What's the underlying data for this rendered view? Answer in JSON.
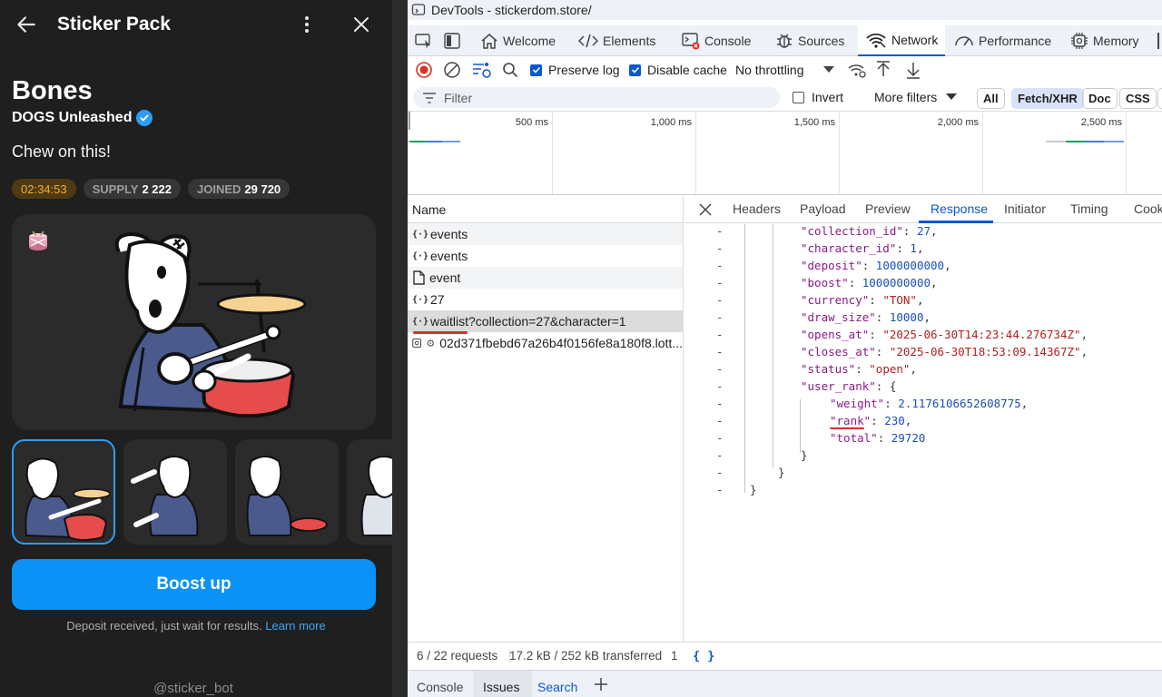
{
  "telegram": {
    "header": {
      "title": "Sticker Pack"
    },
    "pack": {
      "name": "Bones",
      "author": "DOGS Unleashed",
      "tagline": "Chew on this!",
      "timer": "02:34:53",
      "supply_label": "SUPPLY",
      "supply_value": "2 222",
      "joined_label": "JOINED",
      "joined_value": "29 720"
    },
    "boost_label": "Boost up",
    "footnote": "Deposit received, just wait for results.",
    "learn_more": "Learn more",
    "bot": "@sticker_bot"
  },
  "devtools": {
    "window_title": "DevTools - stickerdom.store/",
    "tabs": [
      {
        "label": "Welcome",
        "icon": "home-icon"
      },
      {
        "label": "Elements",
        "icon": "code-icon"
      },
      {
        "label": "Console",
        "icon": "console-icon"
      },
      {
        "label": "Sources",
        "icon": "bug-icon"
      },
      {
        "label": "Network",
        "icon": "wifi-icon",
        "active": true
      },
      {
        "label": "Performance",
        "icon": "gauge-icon"
      },
      {
        "label": "Memory",
        "icon": "chip-icon"
      }
    ],
    "toolbar": {
      "preserve_log": "Preserve log",
      "disable_cache": "Disable cache",
      "throttling": "No throttling"
    },
    "filter": {
      "placeholder": "Filter",
      "invert": "Invert",
      "more_filters": "More filters",
      "types": [
        "All",
        "Fetch/XHR",
        "Doc",
        "CSS"
      ]
    },
    "timeline_ticks": [
      "500 ms",
      "1,000 ms",
      "1,500 ms",
      "2,000 ms",
      "2,500 ms"
    ],
    "requests_header": "Name",
    "requests": [
      {
        "name": "events",
        "type": "json"
      },
      {
        "name": "events",
        "type": "json"
      },
      {
        "name": "event",
        "type": "doc"
      },
      {
        "name": "27",
        "type": "json"
      },
      {
        "name": "waitlist?collection=27&character=1",
        "type": "json",
        "selected": true
      },
      {
        "name": "02d371fbebd67a26b4f0156fe8a180f8.lott...",
        "type": "img"
      }
    ],
    "detail_tabs": [
      "Headers",
      "Payload",
      "Preview",
      "Response",
      "Initiator",
      "Timing",
      "Cooki"
    ],
    "active_detail_tab": "Response",
    "response_lines": [
      {
        "key": "collection_id",
        "value": "27",
        "vtype": "n",
        "indent": 2
      },
      {
        "key": "character_id",
        "value": "1",
        "vtype": "n",
        "indent": 2
      },
      {
        "key": "deposit",
        "value": "1000000000",
        "vtype": "n",
        "indent": 2
      },
      {
        "key": "boost",
        "value": "1000000000",
        "vtype": "n",
        "indent": 2
      },
      {
        "key": "currency",
        "value": "\"TON\"",
        "vtype": "s",
        "indent": 2
      },
      {
        "key": "draw_size",
        "value": "10000",
        "vtype": "n",
        "indent": 2
      },
      {
        "key": "opens_at",
        "value": "\"2025-06-30T14:23:44.276734Z\"",
        "vtype": "s",
        "indent": 2
      },
      {
        "key": "closes_at",
        "value": "\"2025-06-30T18:53:09.14367Z\"",
        "vtype": "s",
        "indent": 2
      },
      {
        "key": "status",
        "value": "\"open\"",
        "vtype": "s",
        "indent": 2
      },
      {
        "key": "user_rank",
        "value": "{",
        "vtype": "p",
        "indent": 2
      },
      {
        "key": "weight",
        "value": "2.1176106652608775",
        "vtype": "n",
        "indent": 3
      },
      {
        "key": "rank",
        "value": "230",
        "vtype": "n",
        "indent": 3
      },
      {
        "key": "total",
        "value": "29720",
        "vtype": "n",
        "indent": 3
      },
      {
        "key": "",
        "value": "}",
        "vtype": "p",
        "indent": 2
      },
      {
        "key": "",
        "value": "}",
        "vtype": "p",
        "indent": 1
      },
      {
        "key": "",
        "value": "}",
        "vtype": "p",
        "indent": 0
      }
    ],
    "status": {
      "requests": "6 / 22 requests",
      "transferred": "17.2 kB / 252 kB transferred",
      "extra": "1",
      "format": "{ }"
    },
    "drawer_tabs": [
      "Console",
      "Issues",
      "Search"
    ]
  },
  "colors": {
    "accent": "#0a92f7",
    "devtools_blue": "#0b57d0",
    "timer": "#f0b030",
    "annotation_red": "#d63030"
  }
}
